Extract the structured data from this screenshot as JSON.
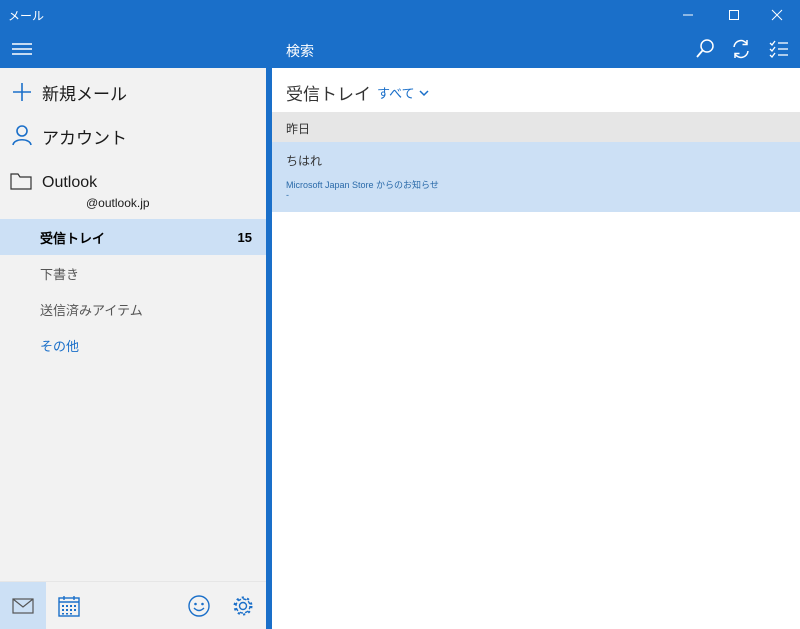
{
  "window": {
    "title": "メール"
  },
  "sidebar": {
    "new_mail_label": "新規メール",
    "account_label": "アカウント",
    "account_name": "Outlook",
    "account_email": "@outlook.jp",
    "folders": [
      {
        "label": "受信トレイ",
        "count": "15"
      },
      {
        "label": "下書き"
      },
      {
        "label": "送信済みアイテム"
      },
      {
        "label": "その他"
      }
    ]
  },
  "header": {
    "search_label": "検索"
  },
  "inbox": {
    "title": "受信トレイ",
    "filter_label": "すべて",
    "group_label": "昨日",
    "messages": [
      {
        "sender": "ちはれ",
        "preview": "Microsoft Japan Store からのお知らせ",
        "preview2": "-"
      }
    ]
  },
  "colors": {
    "accent": "#1a6fc9",
    "selected": "#cce0f5",
    "pane_bg": "#f2f2f2",
    "group_bg": "#e6e6e6"
  },
  "icons": [
    "minimize-icon",
    "maximize-icon",
    "close-icon",
    "hamburger-icon",
    "plus-icon",
    "person-icon",
    "folder-icon",
    "search-icon",
    "sync-icon",
    "select-mode-icon",
    "chevron-down-icon",
    "mail-icon",
    "calendar-icon",
    "smiley-icon",
    "settings-icon"
  ]
}
